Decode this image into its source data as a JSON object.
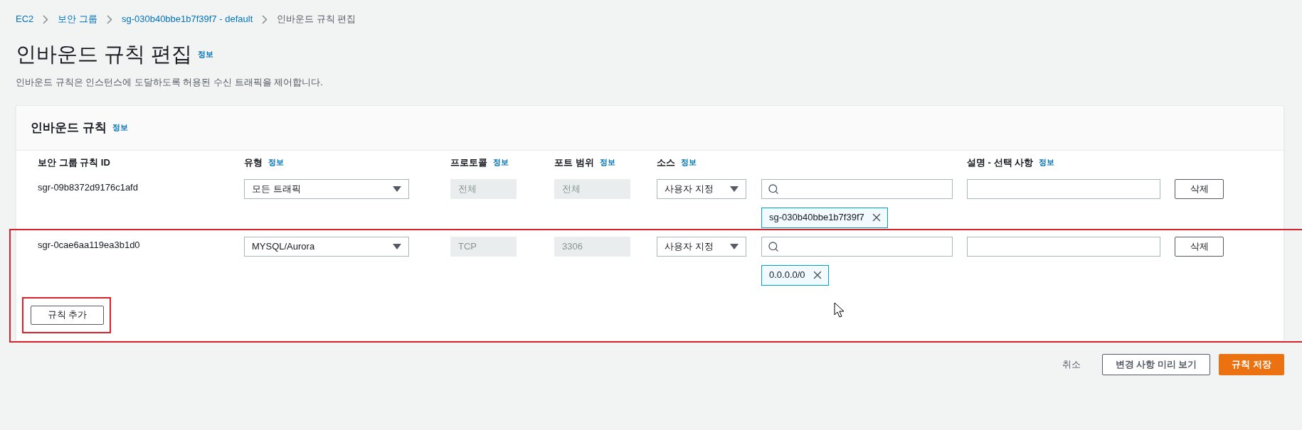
{
  "breadcrumb": [
    {
      "label": "EC2",
      "link": true
    },
    {
      "label": "보안 그룹",
      "link": true
    },
    {
      "label": "sg-030b40bbe1b7f39f7 - default",
      "link": true
    },
    {
      "label": "인바운드 규칙 편집",
      "link": false
    }
  ],
  "page": {
    "title": "인바운드 규칙 편집",
    "info": "정보",
    "description": "인바운드 규칙은 인스턴스에 도달하도록 허용된 수신 트래픽을 제어합니다."
  },
  "panel": {
    "title": "인바운드 규칙",
    "info": "정보",
    "columns": [
      {
        "label": "보안 그룹 규칙 ID"
      },
      {
        "label": "유형",
        "info": "정보"
      },
      {
        "label": "프로토콜",
        "info": "정보"
      },
      {
        "label": "포트 범위",
        "info": "정보"
      },
      {
        "label": "소스",
        "info": "정보"
      },
      {
        "label": "설명 - 선택 사항",
        "info": "정보"
      }
    ],
    "rules": [
      {
        "id": "sgr-09b8372d9176c1afd",
        "type": "모든 트래픽",
        "protocol": "전체",
        "port_range": "전체",
        "source_type": "사용자 지정",
        "sources": [
          "sg-030b40bbe1b7f39f7"
        ],
        "delete": "삭제",
        "highlighted": false
      },
      {
        "id": "sgr-0cae6aa119ea3b1d0",
        "type": "MYSQL/Aurora",
        "protocol": "TCP",
        "port_range": "3306",
        "source_type": "사용자 지정",
        "sources": [
          "0.0.0.0/0"
        ],
        "delete": "삭제",
        "highlighted": true
      }
    ],
    "add_button": {
      "label": "규칙 추가",
      "highlighted": true
    }
  },
  "footer": {
    "cancel": "취소",
    "preview": "변경 사항 미리 보기",
    "save": "규칙 저장"
  }
}
